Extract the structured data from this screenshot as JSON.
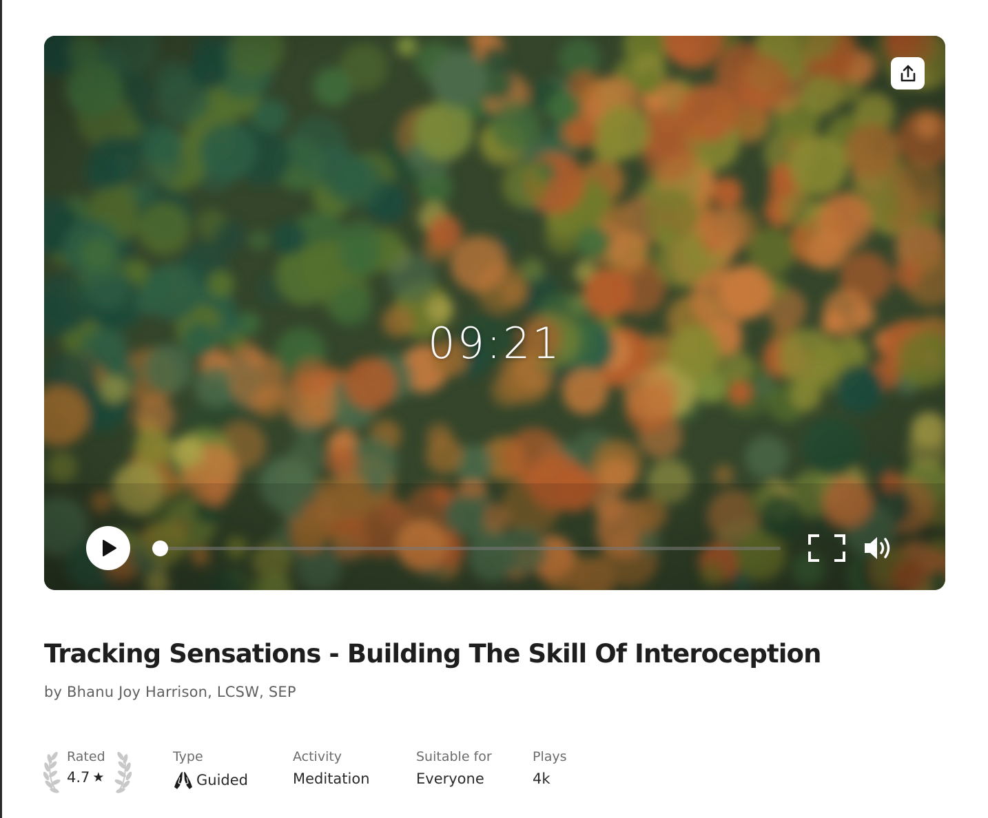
{
  "player": {
    "timer": "09:21",
    "progress_fraction": 0.0,
    "icons": {
      "share": "share-icon",
      "play": "play-icon",
      "fullscreen": "fullscreen-icon",
      "volume": "volume-icon"
    }
  },
  "track": {
    "title": "Tracking Sensations - Building The Skill Of Interoception",
    "author": "by Bhanu Joy Harrison, LCSW, SEP"
  },
  "meta": {
    "rated": {
      "label": "Rated",
      "value": "4.7",
      "star": "★"
    },
    "type": {
      "label": "Type",
      "value": "Guided",
      "icon": "praying-hands-icon"
    },
    "activity": {
      "label": "Activity",
      "value": "Meditation"
    },
    "suitable": {
      "label": "Suitable for",
      "value": "Everyone"
    },
    "plays": {
      "label": "Plays",
      "value": "4k"
    }
  },
  "colors": {
    "accent": "#ffffff",
    "text_primary": "#1e1e1e",
    "text_secondary": "#5f5f5f"
  }
}
